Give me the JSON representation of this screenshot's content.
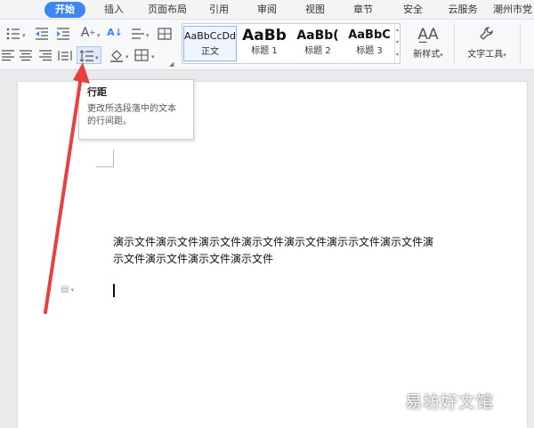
{
  "menu_tabs": [
    "开始",
    "插入",
    "页面布局",
    "引用",
    "审阅",
    "视图",
    "章节",
    "安全",
    "云服务",
    "潮州市党"
  ],
  "styles": [
    {
      "sample": "AaBbCcDd",
      "name": "正文"
    },
    {
      "sample": "AaBb",
      "name": "标题 1"
    },
    {
      "sample": "AaBb(",
      "name": "标题 2"
    },
    {
      "sample": "AaBbC",
      "name": "标题 3"
    }
  ],
  "new_style_label": "新样式",
  "text_tools_label": "文字工具",
  "tooltip": {
    "title": "行距",
    "desc_line1": "更改所选段落中的文本",
    "desc_line2": "的行间距。"
  },
  "document": {
    "line1": "演示文件演示文件演示文件演示文件演示文件演示示文件演示文件演",
    "line2": "示文件演示文件演示文件演示文件"
  },
  "watermark": "易坊好文馆",
  "accent_color": "#3f86f4",
  "arrow_color": "#e8403f"
}
